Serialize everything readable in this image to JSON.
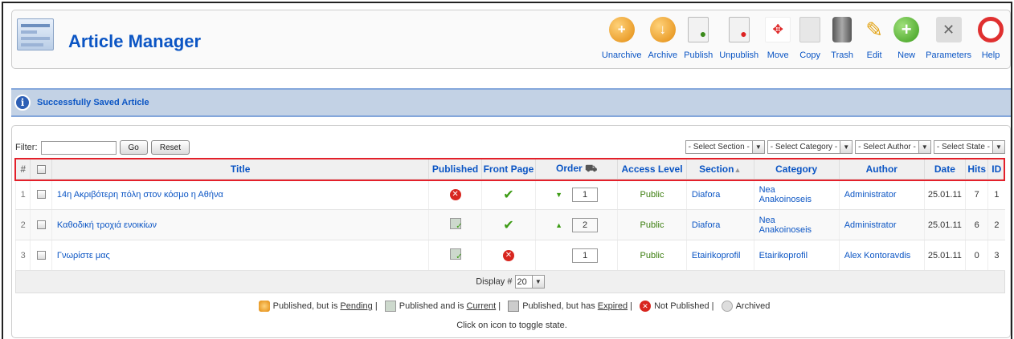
{
  "header": {
    "title": "Article Manager"
  },
  "toolbar": {
    "buttons": [
      {
        "label": "Unarchive",
        "icon": "unarchive-icon"
      },
      {
        "label": "Archive",
        "icon": "archive-icon"
      },
      {
        "label": "Publish",
        "icon": "publish-icon"
      },
      {
        "label": "Unpublish",
        "icon": "unpublish-icon"
      },
      {
        "label": "Move",
        "icon": "move-icon"
      },
      {
        "label": "Copy",
        "icon": "copy-icon"
      },
      {
        "label": "Trash",
        "icon": "trash-icon"
      },
      {
        "label": "Edit",
        "icon": "edit-icon"
      },
      {
        "label": "New",
        "icon": "new-icon"
      },
      {
        "label": "Parameters",
        "icon": "parameters-icon"
      },
      {
        "label": "Help",
        "icon": "help-icon"
      }
    ]
  },
  "message": {
    "text": "Successfully Saved Article"
  },
  "filter": {
    "label": "Filter:",
    "value": "",
    "go": "Go",
    "reset": "Reset",
    "selects": [
      "- Select Section -",
      "- Select Category -",
      "- Select Author -",
      "- Select State -"
    ]
  },
  "table": {
    "headers": {
      "num": "#",
      "title": "Title",
      "published": "Published",
      "frontpage": "Front Page",
      "order": "Order",
      "access": "Access Level",
      "section": "Section",
      "category": "Category",
      "author": "Author",
      "date": "Date",
      "hits": "Hits",
      "id": "ID"
    },
    "rows": [
      {
        "num": "1",
        "title": "14η Ακριβότερη πόλη στον κόσμο η Αθήνα",
        "published": "not-published",
        "frontpage": "yes",
        "order": "1",
        "access": "Public",
        "section": "Diafora",
        "category": "Nea Anakoinoseis",
        "author": "Administrator",
        "date": "25.01.11",
        "hits": "7",
        "id": "1"
      },
      {
        "num": "2",
        "title": "Καθοδική τροχιά ενοικίων",
        "published": "published-current",
        "frontpage": "yes",
        "order": "2",
        "access": "Public",
        "section": "Diafora",
        "category": "Nea Anakoinoseis",
        "author": "Administrator",
        "date": "25.01.11",
        "hits": "6",
        "id": "2"
      },
      {
        "num": "3",
        "title": "Γνωρίστε μας",
        "published": "published-current",
        "frontpage": "no",
        "order": "1",
        "access": "Public",
        "section": "Etairikoprofil",
        "category": "Etairikoprofil",
        "author": "Alex Kontoravdis",
        "date": "25.01.11",
        "hits": "0",
        "id": "3"
      }
    ]
  },
  "pagination": {
    "label": "Display #",
    "value": "20"
  },
  "legend": {
    "pending_pre": "Published, but is ",
    "pending_word": "Pending",
    "current_pre": "Published and is ",
    "current_word": "Current",
    "expired_pre": "Published, but has ",
    "expired_word": "Expired",
    "not_published": "Not Published",
    "archived": "Archived",
    "separator": "|",
    "click_note": "Click on icon to toggle state."
  },
  "colors": {
    "link": "#0b55c4",
    "highlight": "#e3202a",
    "message_bg": "#c3d2e5"
  }
}
